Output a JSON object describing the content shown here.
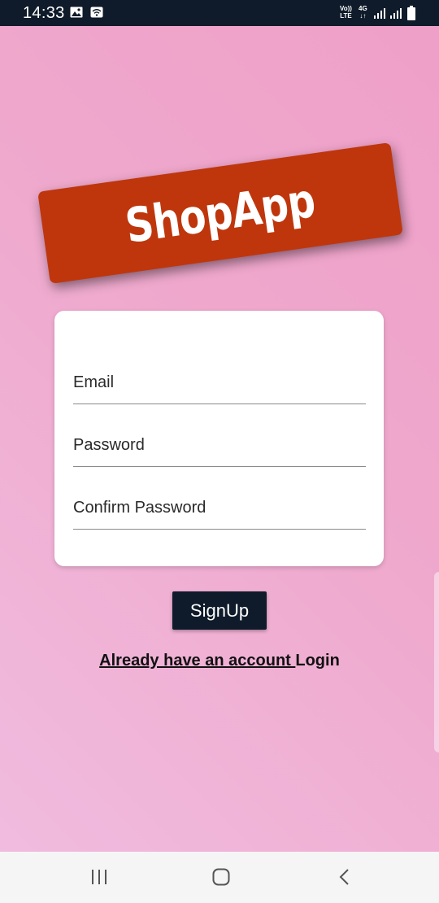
{
  "status_bar": {
    "time": "14:33",
    "volte_line1": "Vo))",
    "volte_line2": "LTE",
    "network_line1": "4G",
    "network_line2": "↓↑",
    "icons": [
      "gallery-icon",
      "wifi-icon",
      "signal-icon",
      "signal-icon",
      "battery-icon"
    ]
  },
  "logo": {
    "text": "ShopApp",
    "color": "#bf360c"
  },
  "form": {
    "email_label": "Email",
    "password_label": "Password",
    "confirm_password_label": "Confirm Password"
  },
  "signup_button": {
    "label": "SignUp",
    "color": "#0f1b2a"
  },
  "login_link": {
    "prefix": "Already have an account ",
    "action": "Login"
  },
  "nav_bar": {
    "icons": [
      "recents-icon",
      "home-icon",
      "back-icon"
    ]
  }
}
